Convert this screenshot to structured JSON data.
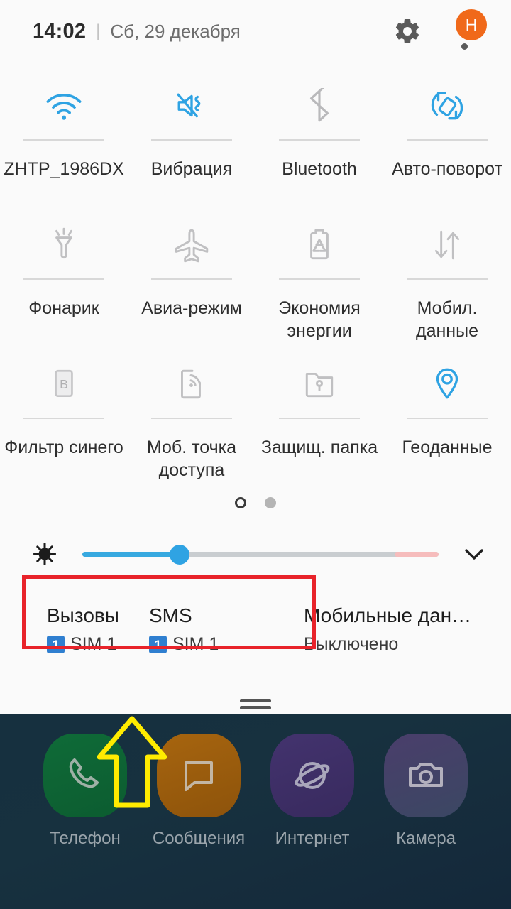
{
  "status_bar": {
    "time": "14:02",
    "separator": "|",
    "date": "Сб, 29 декабря",
    "settings_icon": "gear-icon",
    "menu_icon": "kebab-menu-icon",
    "avatar_initial": "Н",
    "avatar_color": "#f0691a"
  },
  "quick_settings": {
    "active_color": "#2fa3e3",
    "inactive_color": "#c0c0c2",
    "rows": [
      {
        "tiles": [
          {
            "icon": "wifi-icon",
            "label": "ZHTP_1986DX",
            "state": "on"
          },
          {
            "icon": "vibrate-icon",
            "label": "Вибрация",
            "state": "on"
          },
          {
            "icon": "bluetooth-icon",
            "label": "Bluetooth",
            "state": "off"
          },
          {
            "icon": "auto-rotate-icon",
            "label": "Авто-поворот",
            "state": "on"
          }
        ]
      },
      {
        "tiles": [
          {
            "icon": "flashlight-icon",
            "label": "Фонарик",
            "state": "off"
          },
          {
            "icon": "airplane-icon",
            "label": "Авиа-режим",
            "state": "off"
          },
          {
            "icon": "power-saving-icon",
            "label": "Экономия энергии",
            "state": "off"
          },
          {
            "icon": "mobile-data-icon",
            "label": "Мобил. данные",
            "state": "off"
          }
        ]
      },
      {
        "tiles": [
          {
            "icon": "blue-light-filter-icon",
            "label": "Фильтр синего",
            "state": "off"
          },
          {
            "icon": "hotspot-icon",
            "label": "Моб. точка доступа",
            "state": "off"
          },
          {
            "icon": "secure-folder-icon",
            "label": "Защищ. папка",
            "state": "off"
          },
          {
            "icon": "location-icon",
            "label": "Геоданные",
            "state": "on"
          }
        ]
      }
    ],
    "page_indicator": {
      "pages": 2,
      "current": 1
    }
  },
  "brightness": {
    "icon": "brightness-icon",
    "value_percent": 27,
    "expand_icon": "chevron-down-icon"
  },
  "info_strip": {
    "highlight_color": "#e8232a",
    "calls": {
      "title": "Вызовы",
      "sim_badge": "1",
      "sim_label": "SIM 1"
    },
    "sms": {
      "title": "SMS",
      "sim_badge": "1",
      "sim_label": "SIM 1"
    },
    "mobile_data": {
      "title": "Мобильные дан…",
      "status": "Выключено"
    }
  },
  "panel_handle": "drag-handle",
  "annotation": {
    "arrow": "yellow-up-arrow",
    "color": "#ffeb00"
  },
  "home_screen": {
    "dock": [
      {
        "icon": "phone-icon",
        "label": "Телефон"
      },
      {
        "icon": "messages-icon",
        "label": "Сообщения"
      },
      {
        "icon": "internet-icon",
        "label": "Интернет"
      },
      {
        "icon": "camera-icon",
        "label": "Камера"
      }
    ]
  }
}
